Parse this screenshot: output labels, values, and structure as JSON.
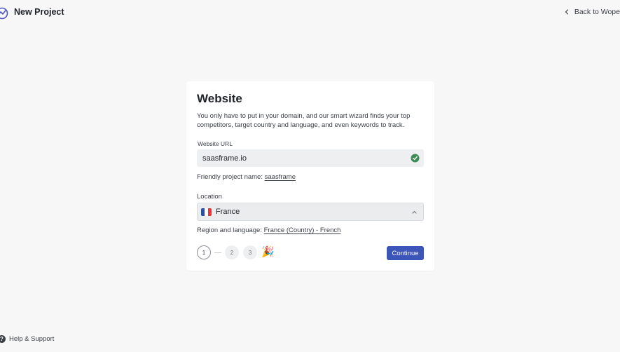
{
  "header": {
    "title": "New Project",
    "back_label": "Back to Wope",
    "logo_icon": "wave-chart-icon",
    "brand_color": "#4a56c9"
  },
  "card": {
    "title": "Website",
    "description": "You only have to put in your domain, and our smart wizard finds your top competitors, target country and language, and even keywords to track.",
    "url_field": {
      "label": "Website URL",
      "value": "saasframe.io",
      "status_icon": "check-circle-icon",
      "status_color": "#3d8c54"
    },
    "friendly_name": {
      "prefix": "Friendly project name:",
      "value": "saasframe"
    },
    "location": {
      "label": "Location",
      "selected": "France",
      "flag_icon": "france-flag-icon"
    },
    "region": {
      "prefix": "Region and language:",
      "value": "France (Country) - French"
    },
    "steps": [
      "1",
      "2",
      "3"
    ],
    "current_step": "1",
    "celebration_icon": "🎉",
    "continue_label": "Continue",
    "accent_color": "#3c55b8"
  },
  "footer": {
    "help_label": "Help & Support",
    "help_icon": "?"
  }
}
